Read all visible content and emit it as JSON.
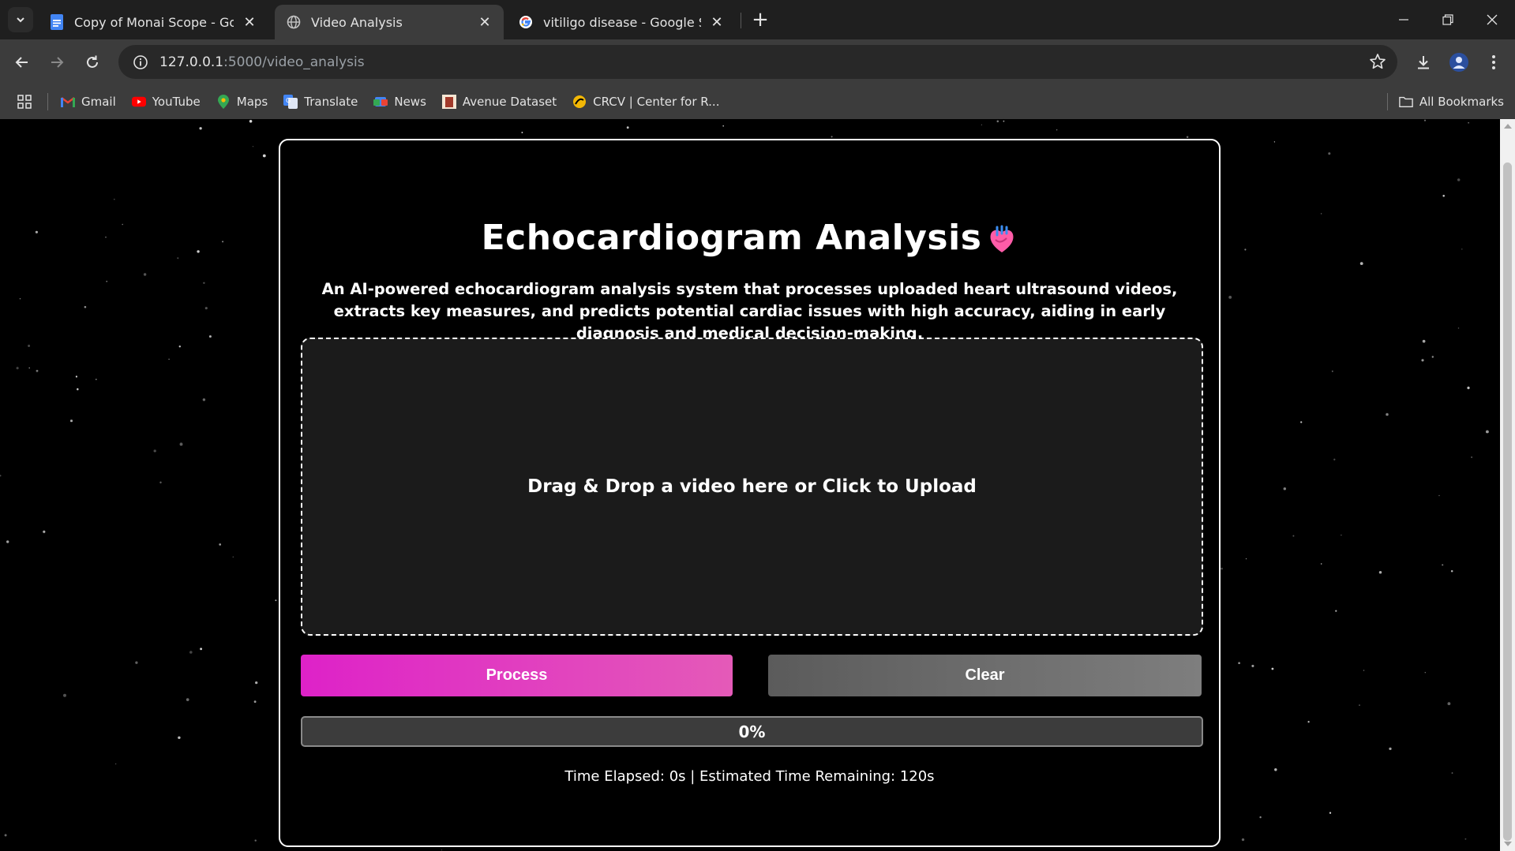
{
  "browser": {
    "tabs": [
      {
        "title": "Copy of Monai Scope - Google",
        "favicon": "google-docs-icon",
        "active": false
      },
      {
        "title": "Video Analysis",
        "favicon": "globe-icon",
        "active": true
      },
      {
        "title": "vitiligo disease - Google Search",
        "favicon": "google-icon",
        "active": false
      }
    ],
    "url_host": "127.0.0.1",
    "url_path": ":5000/video_analysis",
    "bookmarks": [
      {
        "label": "Gmail",
        "icon": "gmail-icon"
      },
      {
        "label": "YouTube",
        "icon": "youtube-icon"
      },
      {
        "label": "Maps",
        "icon": "maps-icon"
      },
      {
        "label": "Translate",
        "icon": "translate-icon"
      },
      {
        "label": "News",
        "icon": "news-icon"
      },
      {
        "label": "Avenue Dataset",
        "icon": "avenue-icon"
      },
      {
        "label": "CRCV | Center for R...",
        "icon": "crcv-icon"
      }
    ],
    "all_bookmarks": "All Bookmarks"
  },
  "page": {
    "title": "Echocardiogram Analysis",
    "description": "An AI-powered echocardiogram analysis system that processes uploaded heart ultrasound videos, extracts key measures, and predicts potential cardiac issues with high accuracy, aiding in early diagnosis and medical decision-making.",
    "dropzone_text": "Drag & Drop a video here or Click to Upload",
    "process_label": "Process",
    "clear_label": "Clear",
    "progress_percent": 0,
    "progress_text": "0%",
    "timer_text": "Time Elapsed: 0s | Estimated Time Remaining: 120s"
  },
  "colors": {
    "accent": "#de22c8",
    "clear_button": "#6b6b6b",
    "background": "#000000"
  }
}
